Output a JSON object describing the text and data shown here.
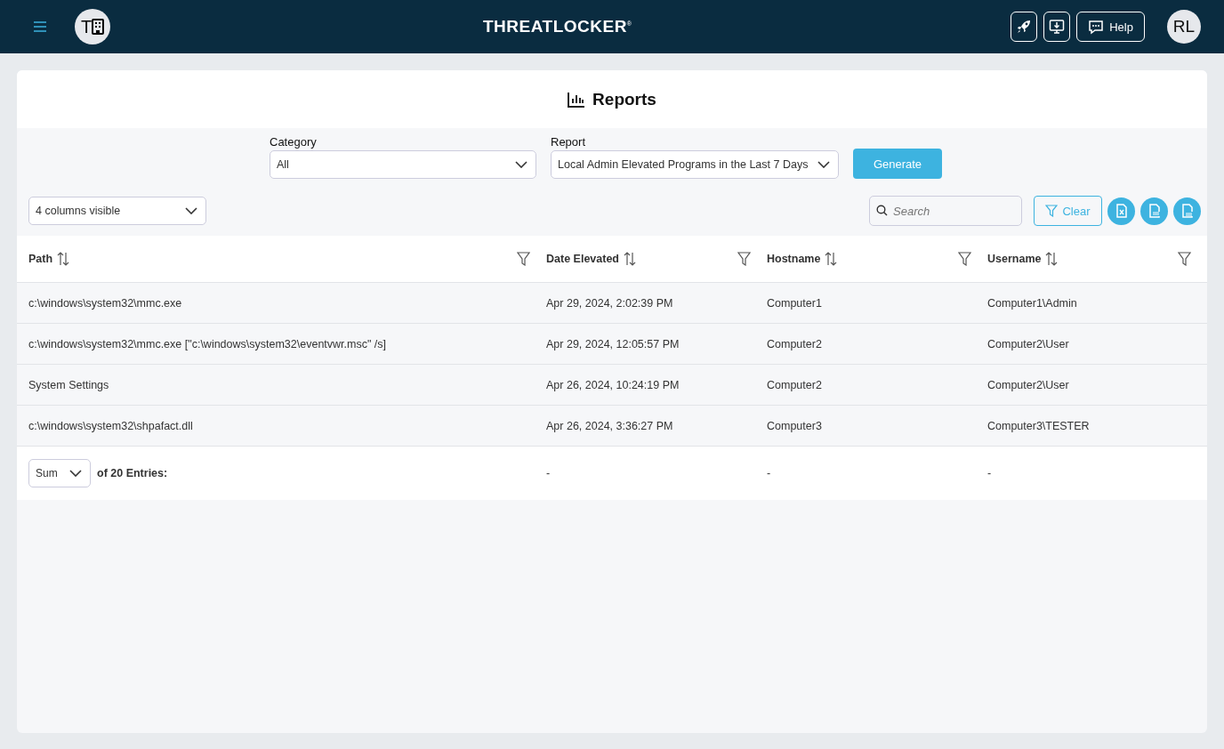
{
  "header": {
    "org_initial": "T",
    "logo": "THREATLOCKER",
    "logo_mark": "®",
    "help": "Help",
    "user_initials": "RL"
  },
  "page": {
    "title": "Reports"
  },
  "filters": {
    "category_label": "Category",
    "category_value": "All",
    "report_label": "Report",
    "report_value": "Local Admin Elevated Programs in the Last 7 Days",
    "generate": "Generate"
  },
  "toolbar": {
    "columns_visible": "4 columns visible",
    "search_placeholder": "Search",
    "clear": "Clear"
  },
  "table": {
    "columns": [
      "Path",
      "Date Elevated",
      "Hostname",
      "Username"
    ],
    "rows": [
      [
        "c:\\windows\\system32\\mmc.exe",
        "Apr 29, 2024, 2:02:39 PM",
        "Computer1",
        "Computer1\\Admin"
      ],
      [
        "c:\\windows\\system32\\mmc.exe [\"c:\\windows\\system32\\eventvwr.msc\" /s]",
        "Apr 29, 2024, 12:05:57 PM",
        "Computer2",
        "Computer2\\User"
      ],
      [
        "System Settings",
        "Apr 26, 2024, 10:24:19 PM",
        "Computer2",
        "Computer2\\User"
      ],
      [
        "c:\\windows\\system32\\shpafact.dll",
        "Apr 26, 2024, 3:36:27 PM",
        "Computer3",
        "Computer3\\TESTER"
      ]
    ],
    "footer": {
      "aggregate": "Sum",
      "entries": "of 20 Entries:",
      "cells": [
        "-",
        "-",
        "-"
      ]
    }
  }
}
